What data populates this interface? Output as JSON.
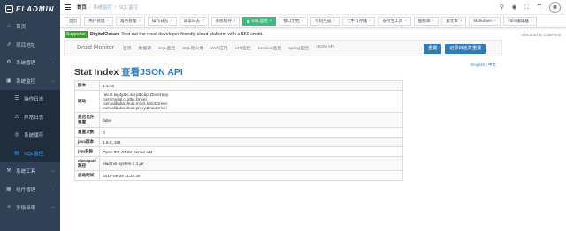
{
  "sidebar": {
    "logo": "ELADMIN",
    "items": [
      {
        "label": "首页",
        "icon": "home-icon",
        "has_arrow": false
      },
      {
        "label": "项目地址",
        "icon": "link-icon",
        "has_arrow": false
      },
      {
        "label": "系统管理",
        "icon": "gear-icon",
        "has_arrow": true
      },
      {
        "label": "系统监控",
        "icon": "monitor-icon",
        "has_arrow": true
      },
      {
        "label": "操作日志",
        "icon": "log-icon",
        "sub": true
      },
      {
        "label": "异常日志",
        "icon": "error-log-icon",
        "sub": true
      },
      {
        "label": "系统缓存",
        "icon": "cache-icon",
        "sub": true
      },
      {
        "label": "SQL监控",
        "icon": "sql-icon",
        "sub": true,
        "active": true
      },
      {
        "label": "系统工具",
        "icon": "tool-icon",
        "has_arrow": true
      },
      {
        "label": "组件管理",
        "icon": "component-icon",
        "has_arrow": true
      },
      {
        "label": "多级菜单",
        "icon": "menu-icon",
        "has_arrow": true
      }
    ]
  },
  "navbar": {
    "breadcrumb": [
      "首页",
      "系统监控",
      "SQL监控"
    ]
  },
  "tags": [
    {
      "label": "首页",
      "closable": false
    },
    {
      "label": "用户管理",
      "closable": true
    },
    {
      "label": "角色管理",
      "closable": true
    },
    {
      "label": "操作日志",
      "closable": true
    },
    {
      "label": "异常日志",
      "closable": true
    },
    {
      "label": "系统缓存",
      "closable": true
    },
    {
      "label": "SQL监控",
      "closable": true,
      "active": true
    },
    {
      "label": "接口文档",
      "closable": true
    },
    {
      "label": "代码生成",
      "closable": true
    },
    {
      "label": "七牛云存储",
      "closable": true
    },
    {
      "label": "支付宝工具",
      "closable": true
    },
    {
      "label": "图标库",
      "closable": true
    },
    {
      "label": "富文本",
      "closable": true
    },
    {
      "label": "Markdown",
      "closable": true
    },
    {
      "label": "Yaml编辑器",
      "closable": true
    }
  ],
  "promo": {
    "badge": "Supporter",
    "brand": "DigitalOcean",
    "text": "Test out the most developer-friendly cloud platform with a $50 credit.",
    "ethical": "ethical ad by CodeFund"
  },
  "druid": {
    "brand": "Druid Monitor",
    "nav": [
      "首页",
      "数据源",
      "SQL监控",
      "SQL防火墙",
      "Web应用",
      "URI监控",
      "Session监控",
      "spring监控",
      "JSON API"
    ],
    "reset_label": "重置",
    "reset_log_label": "记录日志并重置",
    "lang_en": "English",
    "lang_sep": " | ",
    "lang_zh": "中文",
    "title": "Stat Index ",
    "title_link": "查看JSON API",
    "rows": [
      {
        "k": "版本",
        "v": [
          "1.1.10"
        ]
      },
      {
        "k": "驱动",
        "v": [
          "net.sf.log4jdbc.sql.jdbcapi.DriverSpy",
          "com.mysql.cj.jdbc.Driver",
          "com.alibaba.druid.mock.MockDriver",
          "com.alibaba.druid.proxy.DruidDriver"
        ]
      },
      {
        "k": "是否允许重置",
        "v": [
          "false"
        ]
      },
      {
        "k": "重置次数",
        "v": [
          "0"
        ]
      },
      {
        "k": "java版本",
        "v": [
          "1.8.0_181"
        ]
      },
      {
        "k": "jvm名称",
        "v": [
          "OpenJDK 64-Bit Server VM"
        ]
      },
      {
        "k": "classpath路径",
        "v": [
          "eladmin-system-2.1.jar"
        ]
      },
      {
        "k": "启动时间",
        "v": [
          "2019-08-29 11:25:38"
        ]
      }
    ]
  }
}
